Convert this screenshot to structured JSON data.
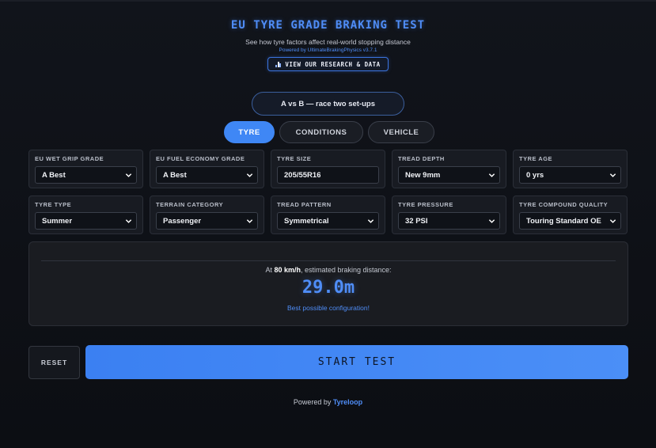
{
  "header": {
    "title": "EU TYRE GRADE BRAKING TEST",
    "subtitle": "See how tyre factors affect real-world stopping distance",
    "powered_small": "Powered by UltimateBrakingPhysics v3.7.1",
    "research_button": "VIEW OUR RESEARCH & DATA"
  },
  "compare_button": "A vs B — race two set-ups",
  "tabs": [
    {
      "label": "TYRE",
      "active": true
    },
    {
      "label": "CONDITIONS",
      "active": false
    },
    {
      "label": "VEHICLE",
      "active": false
    }
  ],
  "fields": [
    {
      "label": "EU WET GRIP GRADE",
      "value": "A Best"
    },
    {
      "label": "EU FUEL ECONOMY GRADE",
      "value": "A Best"
    },
    {
      "label": "TYRE SIZE",
      "value": "205/55R16"
    },
    {
      "label": "TREAD DEPTH",
      "value": "New 9mm"
    },
    {
      "label": "TYRE AGE",
      "value": "0 yrs"
    },
    {
      "label": "TYRE TYPE",
      "value": "Summer"
    },
    {
      "label": "TERRAIN CATEGORY",
      "value": "Passenger"
    },
    {
      "label": "TREAD PATTERN",
      "value": "Symmetrical"
    },
    {
      "label": "TYRE PRESSURE",
      "value": "32 PSI"
    },
    {
      "label": "TYRE COMPOUND QUALITY",
      "value": "Touring Standard OE"
    }
  ],
  "result": {
    "prefix": "At ",
    "speed": "80 km/h",
    "suffix": ", estimated braking distance:",
    "distance": "29.0m",
    "note": "Best possible configuration!"
  },
  "actions": {
    "reset": "RESET",
    "start": "START TEST"
  },
  "footer": {
    "prefix": "Powered by ",
    "brand": "Tyreloop"
  },
  "colors": {
    "accent": "#4f8df7",
    "background": "#0d0f14",
    "panel": "#181b22"
  }
}
